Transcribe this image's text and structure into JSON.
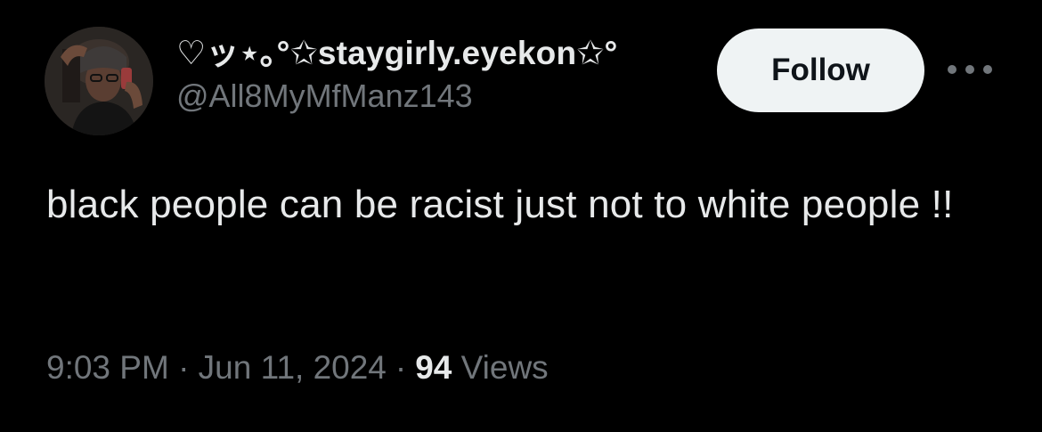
{
  "tweet": {
    "author": {
      "display_name": "♡ッ⋆｡°✩staygirly.eyekon✩°",
      "handle": "@All8MyMfManz143",
      "avatar_icon": "profile-photo"
    },
    "follow_label": "Follow",
    "more_icon": "more-horizontal-icon",
    "text": "black people can be racist just not to white people !!",
    "timestamp": "9:03 PM · Jun 11, 2024",
    "separator": "·",
    "views_count": "94",
    "views_label": "Views"
  },
  "colors": {
    "background": "#000000",
    "primary_text": "#e7e9ea",
    "secondary_text": "#71767b",
    "follow_button_bg": "#eff3f4",
    "follow_button_text": "#0f1419"
  }
}
